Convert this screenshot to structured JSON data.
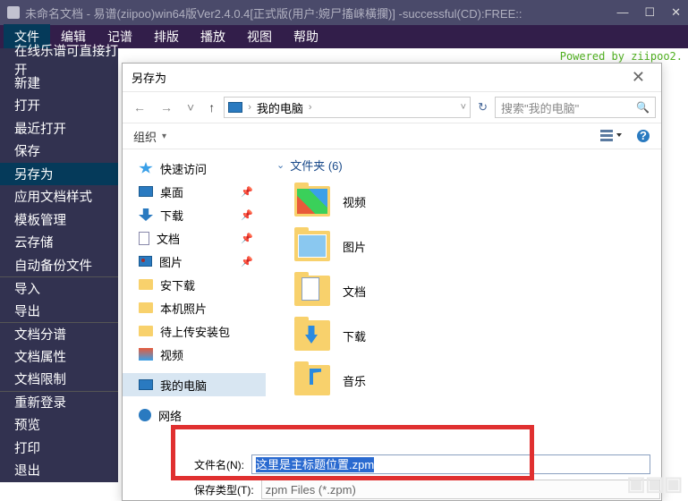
{
  "window": {
    "title": "未命名文档 - 易谱(ziipoo)win64版Ver2.4.0.4[正式版(用户:婉尸搐崃橫攔)] -successful(CD):FREE::"
  },
  "menus": [
    "文件",
    "编辑",
    "记谱",
    "排版",
    "播放",
    "视图",
    "帮助"
  ],
  "powered": "Powered by ziipoo2.",
  "file_menu": [
    "在线乐谱可直接打开",
    "新建",
    "打开",
    "最近打开",
    "保存",
    "另存为",
    "应用文档样式",
    "模板管理",
    "云存储",
    "自动备份文件",
    "导入",
    "导出",
    "文档分谱",
    "文档属性",
    "文档限制",
    "重新登录",
    "预览",
    "打印",
    "退出"
  ],
  "file_menu_selected": 5,
  "file_menu_separators": [
    10,
    12,
    15
  ],
  "dialog": {
    "title": "另存为",
    "path_label": "我的电脑",
    "search_placeholder": "搜索\"我的电脑\"",
    "organize": "组织",
    "sidebar": [
      {
        "label": "快速访问",
        "icon": "star"
      },
      {
        "label": "桌面",
        "icon": "desk",
        "pin": true
      },
      {
        "label": "下载",
        "icon": "dl",
        "pin": true
      },
      {
        "label": "文档",
        "icon": "doc",
        "pin": true
      },
      {
        "label": "图片",
        "icon": "pic",
        "pin": true
      },
      {
        "label": "安下载",
        "icon": "fld"
      },
      {
        "label": "本机照片",
        "icon": "fld"
      },
      {
        "label": "待上传安装包",
        "icon": "fld"
      },
      {
        "label": "视频",
        "icon": "vid"
      },
      {
        "label": "我的电脑",
        "icon": "pc",
        "selected": true
      },
      {
        "label": "网络",
        "icon": "net"
      }
    ],
    "folders_header": "文件夹 (6)",
    "folders": [
      {
        "label": "视频",
        "cls": "bf-vid"
      },
      {
        "label": "图片",
        "cls": "bf-pic"
      },
      {
        "label": "文档",
        "cls": "bf-doc"
      },
      {
        "label": "下载",
        "cls": "bf-dl"
      },
      {
        "label": "音乐",
        "cls": "bf-mus"
      }
    ],
    "filename_label": "文件名(N):",
    "filename_value": "这里是主标题位置.zpm",
    "filetype_label": "保存类型(T):",
    "filetype_value": "zpm Files (*.zpm)"
  }
}
